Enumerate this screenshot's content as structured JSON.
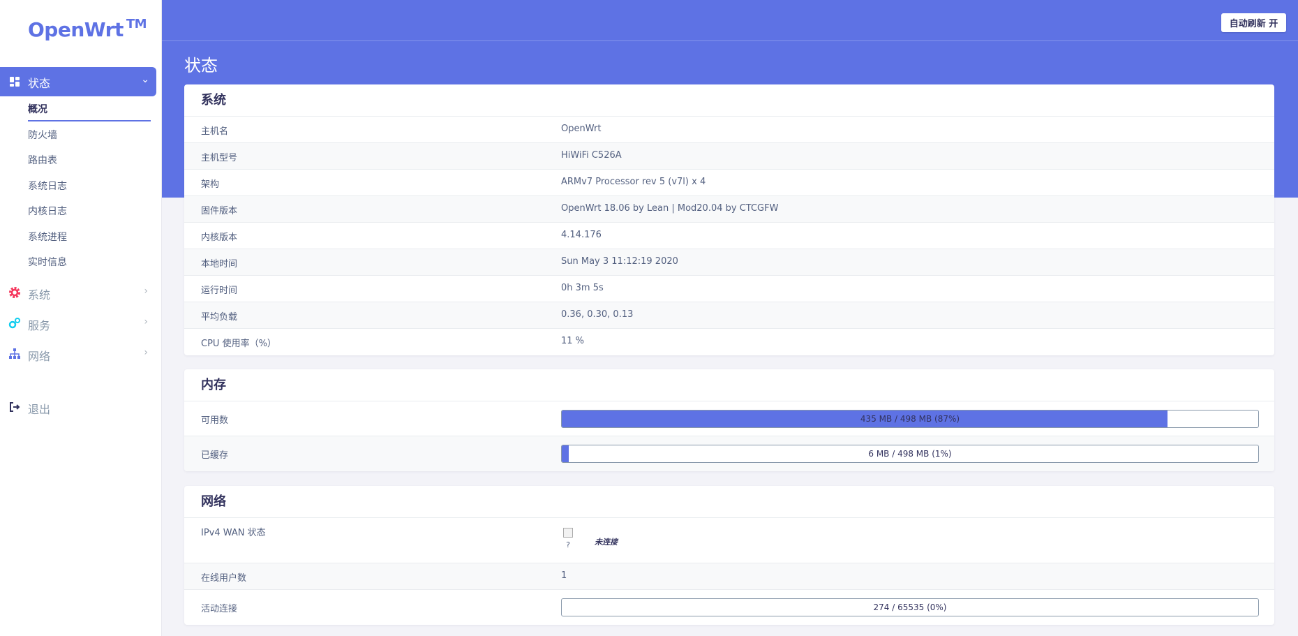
{
  "brand": {
    "name": "OpenWrt",
    "tm": "TM"
  },
  "header": {
    "refresh_button": "自动刷新 开",
    "page_title": "状态"
  },
  "sidebar": {
    "active": {
      "label": "状态",
      "icon": "dashboard-icon"
    },
    "subitems": [
      "概况",
      "防火墙",
      "路由表",
      "系统日志",
      "内核日志",
      "系统进程",
      "实时信息"
    ],
    "items": [
      {
        "label": "系统",
        "icon": "gear-icon",
        "color": "#f5365c"
      },
      {
        "label": "服务",
        "icon": "cogs-icon",
        "color": "#11cdef"
      },
      {
        "label": "网络",
        "icon": "sitemap-icon",
        "color": "#5e72e4"
      }
    ],
    "logout": {
      "label": "退出",
      "icon": "logout-icon"
    }
  },
  "system": {
    "title": "系统",
    "rows": [
      {
        "key": "主机名",
        "value": "OpenWrt"
      },
      {
        "key": "主机型号",
        "value": "HiWiFi C526A"
      },
      {
        "key": "架构",
        "value": "ARMv7 Processor rev 5 (v7l) x 4"
      },
      {
        "key": "固件版本",
        "value": "OpenWrt 18.06 by Lean | Mod20.04 by CTCGFW"
      },
      {
        "key": "内核版本",
        "value": "4.14.176"
      },
      {
        "key": "本地时间",
        "value": "Sun May 3 11:12:19 2020"
      },
      {
        "key": "运行时间",
        "value": "0h 3m 5s"
      },
      {
        "key": "平均负载",
        "value": "0.36, 0.30, 0.13"
      },
      {
        "key": "CPU 使用率（%）",
        "value": "11 %"
      }
    ]
  },
  "memory": {
    "title": "内存",
    "rows": [
      {
        "key": "可用数",
        "bar_text": "435 MB / 498 MB (87%)",
        "percent": 87
      },
      {
        "key": "已缓存",
        "bar_text": "6 MB / 498 MB (1%)",
        "percent": 1
      }
    ]
  },
  "network": {
    "title": "网络",
    "wan": {
      "key": "IPv4 WAN 状态",
      "icon_caption": "?",
      "status": "未连接"
    },
    "online_users": {
      "key": "在线用户数",
      "value": "1"
    },
    "connections": {
      "key": "活动连接",
      "bar_text": "274 / 65535 (0%)",
      "percent": 0
    }
  }
}
